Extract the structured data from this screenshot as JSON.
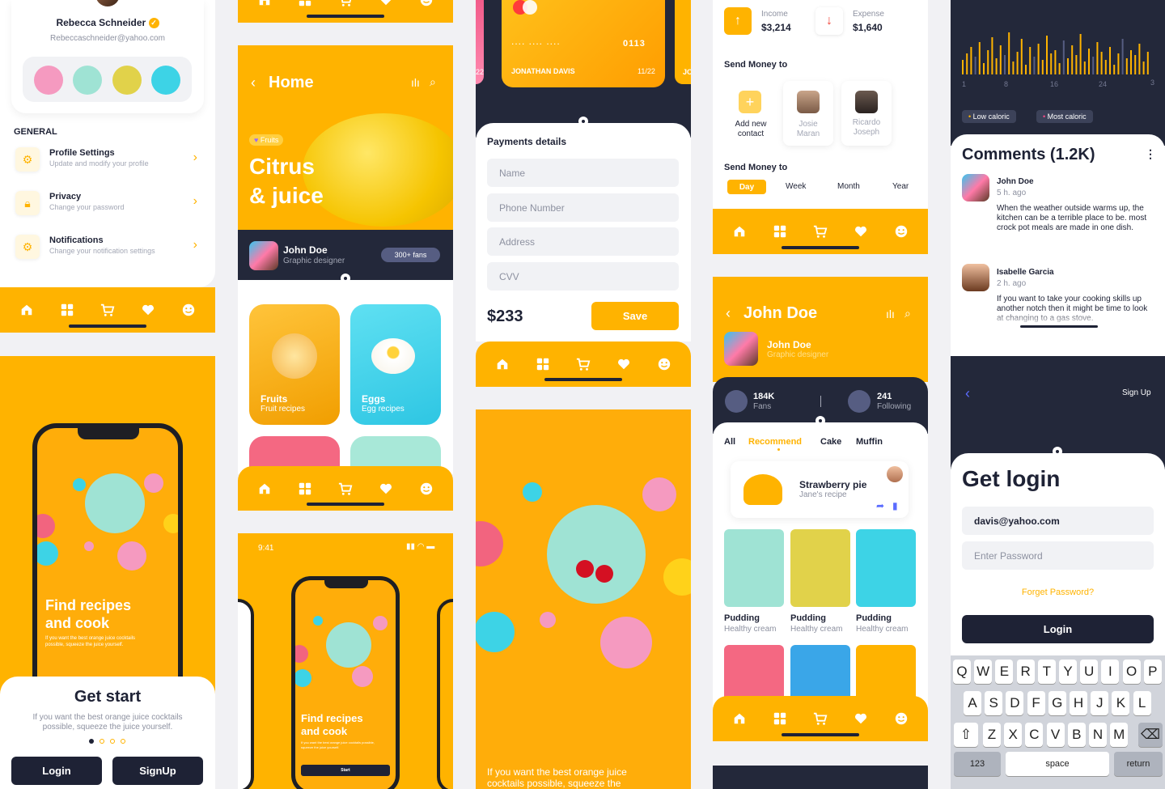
{
  "colors": {
    "accent": "#ffb300",
    "dark": "#23283a",
    "white": "#ffffff"
  },
  "icons": [
    "home-icon",
    "grid-icon",
    "cart-icon",
    "heart-icon",
    "smile-icon",
    "gear-icon",
    "lock-icon",
    "chevron-right-icon",
    "chevron-left-icon",
    "search-icon",
    "stats-icon",
    "arrow-up-icon",
    "arrow-down-icon",
    "plus-icon",
    "share-icon",
    "bookmark-icon",
    "more-icon",
    "verified-icon",
    "shift-icon",
    "backspace-icon"
  ],
  "profile": {
    "name": "Rebecca Schneider",
    "email": "Rebeccaschneider@yahoo.com",
    "section": "GENERAL",
    "items": [
      {
        "title": "Profile Settings",
        "sub": "Update and modify your profile"
      },
      {
        "title": "Privacy",
        "sub": "Change your password"
      },
      {
        "title": "Notifications",
        "sub": "Change your notification settings"
      }
    ]
  },
  "onboarding": {
    "headline_1": "Find recipes",
    "headline_2": "and cook",
    "small": "If you want the best orange juice cocktails possible, squeeze the juice yourself.",
    "title": "Get start",
    "body": "If you want the best orange juice cocktails possible, squeeze the juice yourself.",
    "login": "Login",
    "signup": "SignUp"
  },
  "home": {
    "back": "Home",
    "tag": "Fruits",
    "title_1": "Citrus",
    "title_2": "& juice",
    "user": "John Doe",
    "role": "Graphic designer",
    "fans": "300+ fans",
    "cards": [
      {
        "title": "Fruits",
        "sub": "Fruit recipes"
      },
      {
        "title": "Eggs",
        "sub": "Egg recipes"
      }
    ]
  },
  "phone_mock": {
    "time": "9:41",
    "headline_1": "Find recipes",
    "headline_2": "and cook",
    "small": "If you want the best orange juice cocktails possible, squeeze the juice yourself.",
    "start": "Start"
  },
  "payment": {
    "card_dots": "....   ....   ....",
    "card_last": "0113",
    "holder": "JONATHAN DAVIS",
    "expiry": "11/22",
    "left_frag": "22",
    "right_frag": "JO",
    "title": "Payments details",
    "fields": [
      "Name",
      "Phone Number",
      "Address",
      "CVV"
    ],
    "amount": "$233",
    "save": "Save",
    "bottom_text": "If you want the best orange juice cocktails possible, squeeze the"
  },
  "wallet": {
    "income_label": "Income",
    "income_value": "$3,214",
    "expense_label": "Expense",
    "expense_value": "$1,640",
    "send_title": "Send Money to",
    "contacts": [
      {
        "name_1": "Add new",
        "name_2": "contact"
      },
      {
        "name_1": "Josie",
        "name_2": "Maran"
      },
      {
        "name_1": "Ricardo",
        "name_2": "Joseph"
      }
    ],
    "send_title_2": "Send Money to",
    "periods": [
      "Day",
      "Week",
      "Month",
      "Year"
    ]
  },
  "profile2": {
    "back": "John Doe",
    "name": "John Doe",
    "role": "Graphic designer",
    "fans_value": "184K",
    "fans_label": "Fans",
    "following_value": "241",
    "following_label": "Following",
    "tabs": [
      "All",
      "Recommend",
      "Cake",
      "Muffin"
    ],
    "featured_title": "Strawberry pie",
    "featured_sub": "Jane's recipe",
    "items": [
      {
        "title": "Pudding",
        "sub": "Healthy cream"
      },
      {
        "title": "Pudding",
        "sub": "Healthy cream"
      },
      {
        "title": "Pudding",
        "sub": "Healthy cream"
      }
    ]
  },
  "comments": {
    "axis": [
      "1",
      "8",
      "16",
      "24",
      "3"
    ],
    "legend_low": "Low caloric",
    "legend_high": "Most caloric",
    "title": "Comments (1.2K)",
    "list": [
      {
        "name": "John Doe",
        "time": "5 h. ago",
        "text": "When the weather outside warms up, the kitchen can be a terrible place to be. most crock pot meals are made in one dish."
      },
      {
        "name": "Isabelle Garcia",
        "time": "2 h. ago",
        "text": "If you want to take your cooking skills up another notch then it might be time to look at changing to a gas stove."
      }
    ]
  },
  "login": {
    "signup": "Sign Up",
    "title": "Get login",
    "email": "davis@yahoo.com",
    "password_placeholder": "Enter Password",
    "forgot": "Forget Password?",
    "button": "Login",
    "row1": [
      "Q",
      "W",
      "E",
      "R",
      "T",
      "Y",
      "U",
      "I",
      "O",
      "P"
    ],
    "row2": [
      "A",
      "S",
      "D",
      "F",
      "G",
      "H",
      "J",
      "K",
      "L"
    ],
    "row3": [
      "Z",
      "X",
      "C",
      "V",
      "B",
      "N",
      "M"
    ],
    "k123": "123",
    "space": "space",
    "return": "return"
  }
}
